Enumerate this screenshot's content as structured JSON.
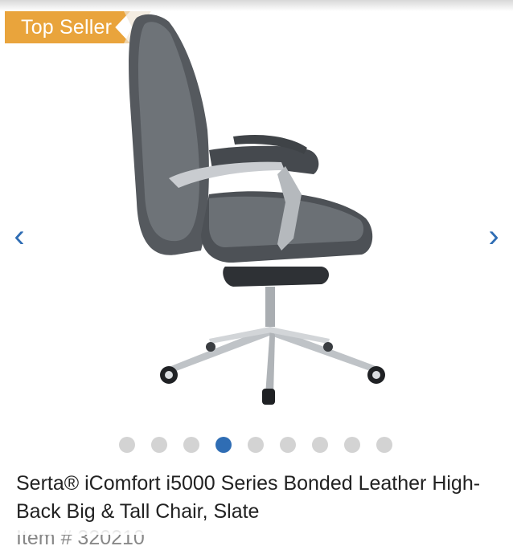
{
  "badge": {
    "label": "Top Seller"
  },
  "gallery": {
    "prev_icon": "‹",
    "next_icon": "›",
    "image_alt": "Serta iComfort i5000 Series chair side view",
    "slide_count": 9,
    "active_slide": 4
  },
  "product": {
    "title": "Serta® iComfort i5000 Series Bonded Leather High-Back Big & Tall Chair, Slate",
    "item_number": "Item # 320210"
  },
  "colors": {
    "accent": "#2f6db4",
    "badge": "#e9a43c",
    "dot_inactive": "#d3d3d3"
  }
}
